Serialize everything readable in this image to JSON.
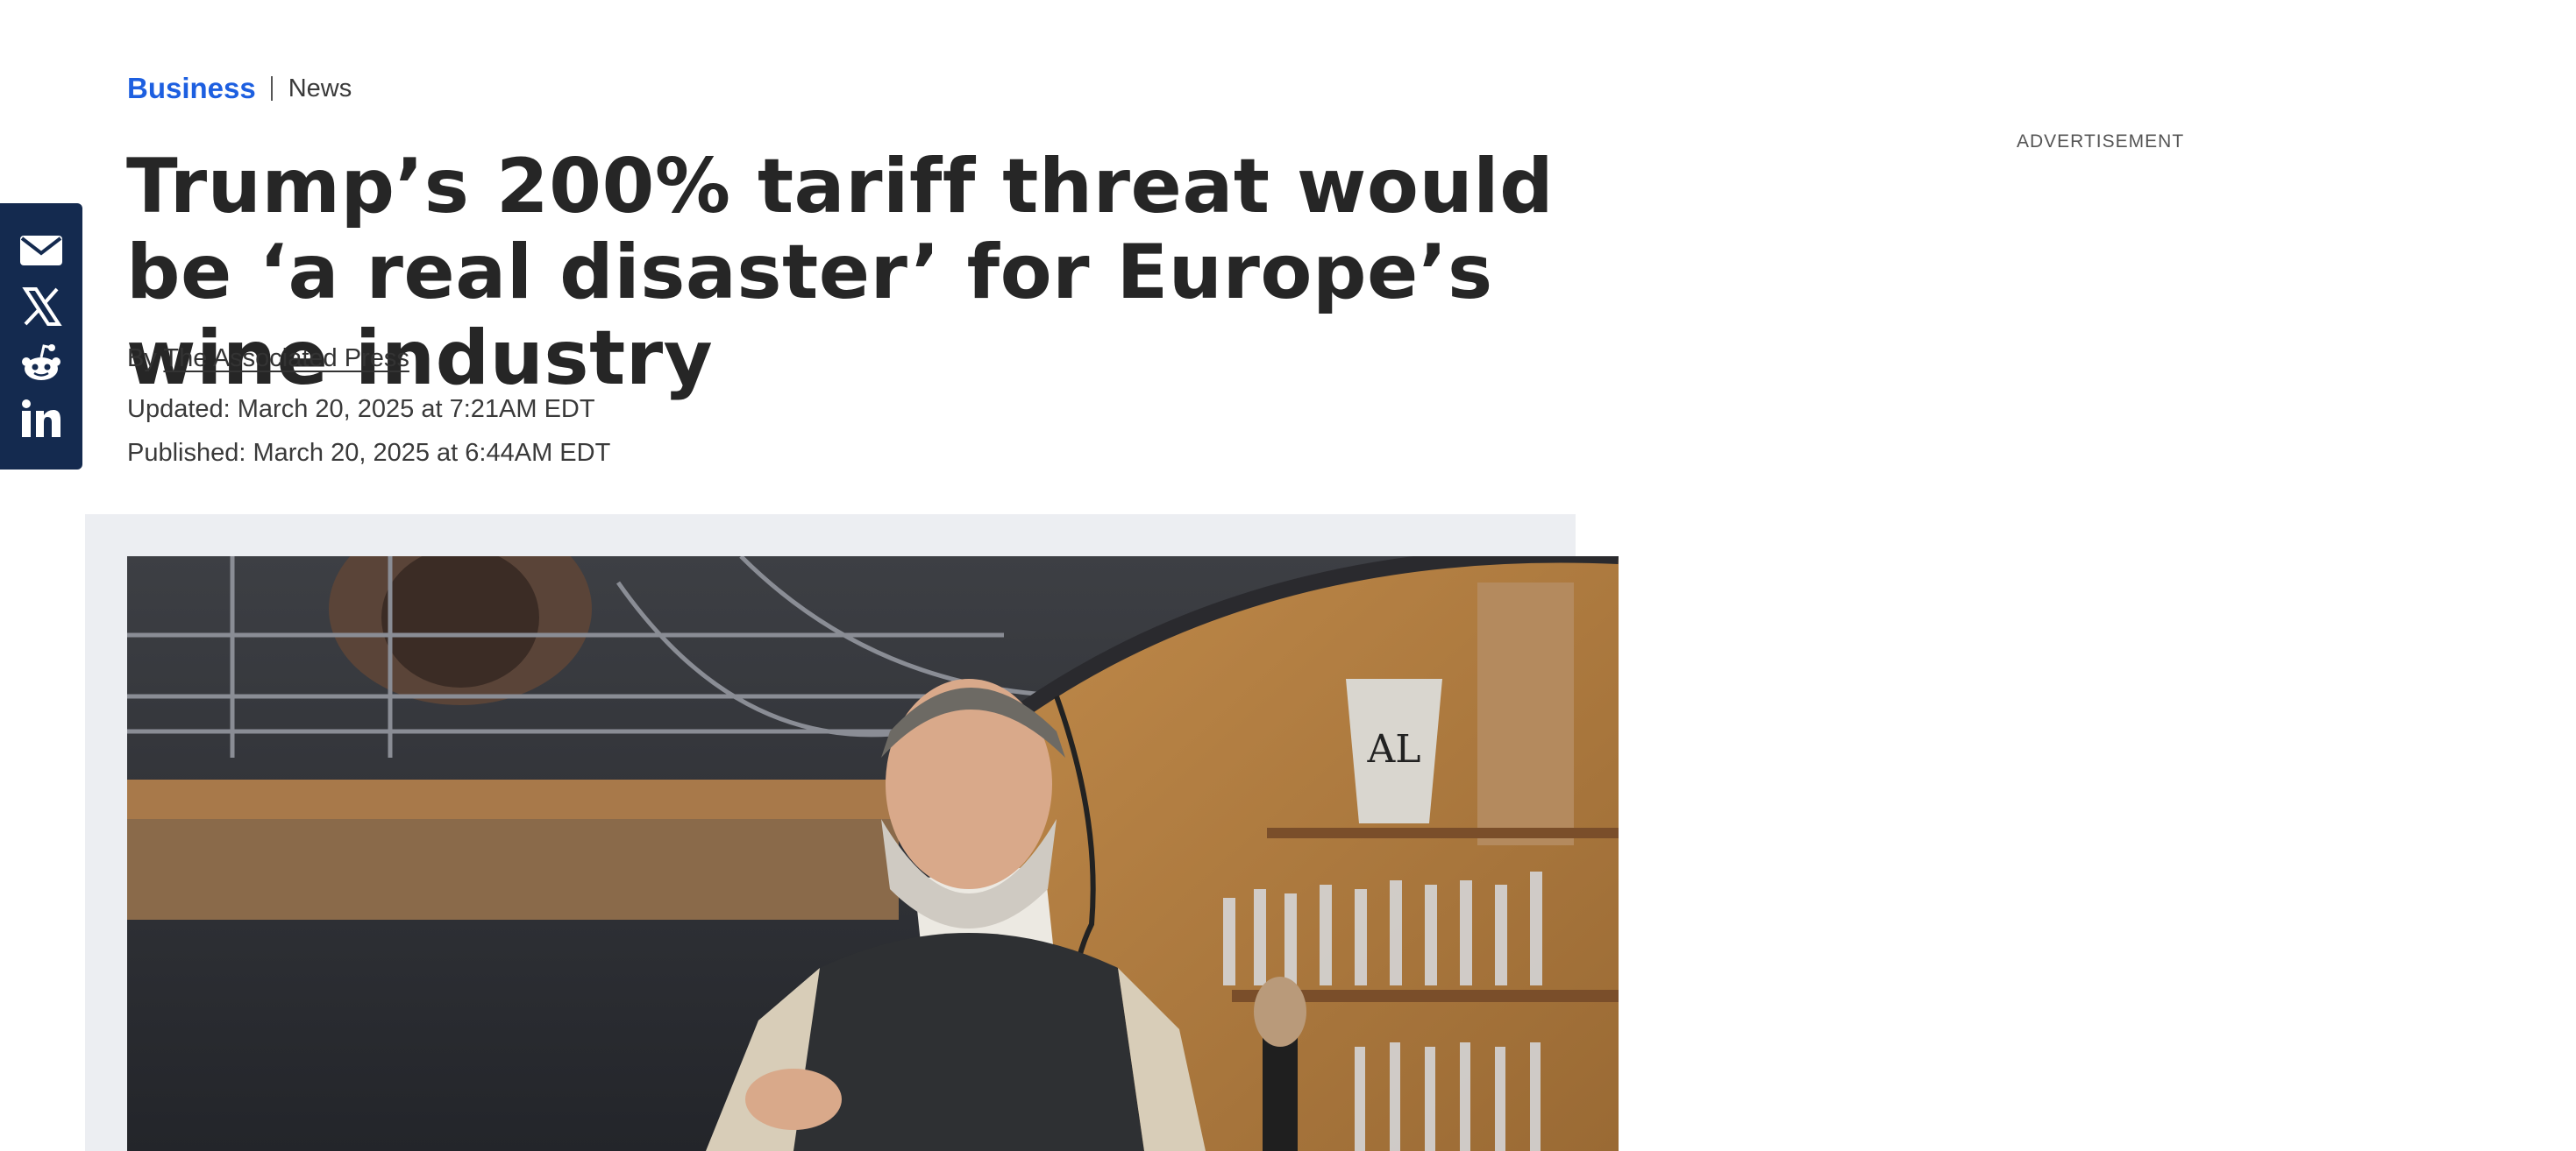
{
  "breadcrumb": {
    "section": "Business",
    "subsection": "News"
  },
  "article": {
    "headline": "Trump’s 200% tariff threat would be ‘a real disaster’ for Europe’s wine industry",
    "byline_prefix": "By",
    "author": "The Associated Press",
    "updated": "Updated: March 20, 2025 at 7:21AM EDT",
    "published": "Published: March 20, 2025 at 6:44AM EDT"
  },
  "ad": {
    "label": "ADVERTISEMENT"
  },
  "share": {
    "items": [
      {
        "icon": "envelope-icon"
      },
      {
        "icon": "x-icon"
      },
      {
        "icon": "reddit-icon"
      },
      {
        "icon": "linkedin-icon"
      }
    ]
  },
  "photo": {
    "ice_bucket_text": "AL"
  },
  "colors": {
    "accent": "#1d5fe0",
    "share_bg": "#142a4f",
    "media_bg": "#eceef2",
    "text": "#262626"
  }
}
